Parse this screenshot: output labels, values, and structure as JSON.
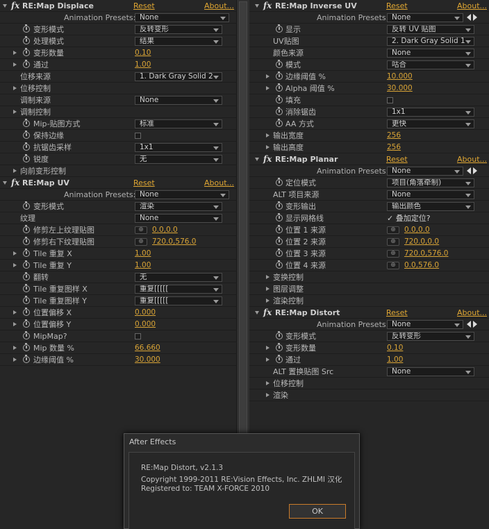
{
  "colors": {
    "accent": "#e0a733",
    "panel_bg": "#262626",
    "text": "#b9b9b9"
  },
  "left": {
    "sections": [
      {
        "name": "RE:Map Displace",
        "reset": "Reset",
        "about": "About...",
        "presets_label": "Animation Presets:",
        "presets_value": "None",
        "rows": [
          {
            "kind": "dd",
            "sw": true,
            "label": "变形模式",
            "value": "反转变形"
          },
          {
            "kind": "dd",
            "sw": true,
            "label": "处理模式",
            "value": "结果"
          },
          {
            "kind": "num",
            "tri": true,
            "sw": true,
            "label": "变形数量",
            "value": "0.10"
          },
          {
            "kind": "num",
            "tri": true,
            "sw": true,
            "label": "通过",
            "value": "1.00"
          },
          {
            "kind": "dd",
            "label": "位移来源",
            "value": "1. Dark Gray Solid 2",
            "indent": 1
          },
          {
            "kind": "group",
            "tri": true,
            "label": "位移控制"
          },
          {
            "kind": "dd",
            "label": "调制来源",
            "value": "None",
            "indent": 1
          },
          {
            "kind": "group",
            "tri": true,
            "label": "调制控制"
          },
          {
            "kind": "dd",
            "sw": true,
            "label": "Mip-贴图方式",
            "value": "标准"
          },
          {
            "kind": "cb",
            "sw": true,
            "label": "保持边缘",
            "value": ""
          },
          {
            "kind": "dd",
            "sw": true,
            "label": "抗锯齿采样",
            "value": "1x1"
          },
          {
            "kind": "dd",
            "sw": true,
            "label": "锐度",
            "value": "无"
          },
          {
            "kind": "group",
            "tri": true,
            "label": "向前变形控制"
          }
        ]
      },
      {
        "name": "RE:Map UV",
        "reset": "Reset",
        "about": "About...",
        "presets_label": "Animation Presets:",
        "presets_value": "None",
        "rows": [
          {
            "kind": "dd",
            "sw": true,
            "label": "变形模式",
            "value": "渲染"
          },
          {
            "kind": "dd",
            "label": "纹理",
            "value": "None",
            "indent": 1
          },
          {
            "kind": "pt",
            "sw": true,
            "label": "修剪左上纹理贴图",
            "value": "0.0,0.0"
          },
          {
            "kind": "pt",
            "sw": true,
            "label": "修剪右下纹理贴图",
            "value": "720.0,576.0"
          },
          {
            "kind": "num",
            "tri": true,
            "sw": true,
            "label": "Tile 重复 X",
            "value": "1.00"
          },
          {
            "kind": "num",
            "tri": true,
            "sw": true,
            "label": "Tile 重复 Y",
            "value": "1.00"
          },
          {
            "kind": "dd",
            "sw": true,
            "label": "翻转",
            "value": "无"
          },
          {
            "kind": "dd",
            "sw": true,
            "label": "Tile 重复图样 X",
            "value": "重复[[[[["
          },
          {
            "kind": "dd",
            "sw": true,
            "label": "Tile 重复图样 Y",
            "value": "重复[[[[["
          },
          {
            "kind": "num",
            "tri": true,
            "sw": true,
            "label": "位置偏移 X",
            "value": "0.000"
          },
          {
            "kind": "num",
            "tri": true,
            "sw": true,
            "label": "位置偏移 Y",
            "value": "0.000"
          },
          {
            "kind": "cb",
            "sw": true,
            "label": "MipMap?",
            "value": ""
          },
          {
            "kind": "num",
            "tri": true,
            "sw": true,
            "label": "Mip 数量 %",
            "value": "66.660"
          },
          {
            "kind": "num",
            "tri": true,
            "sw": true,
            "label": "边缘阈值 %",
            "value": "30.000"
          }
        ]
      }
    ]
  },
  "right": {
    "sections": [
      {
        "name": "RE:Map Inverse UV",
        "reset": "Reset",
        "about": "About...",
        "presets_label": "Animation Presets:",
        "presets_value": "None",
        "rows": [
          {
            "kind": "dd",
            "sw": true,
            "label": "显示",
            "value": "反转 UV 贴图"
          },
          {
            "kind": "dd",
            "label": "UV贴图",
            "value": "2. Dark Gray Solid 1",
            "indent": 1
          },
          {
            "kind": "dd",
            "label": "颜色来源",
            "value": "None",
            "indent": 1
          },
          {
            "kind": "dd",
            "sw": true,
            "label": "模式",
            "value": "咕合"
          },
          {
            "kind": "num",
            "tri": true,
            "sw": true,
            "label": "边缘阈值 %",
            "value": "10.000"
          },
          {
            "kind": "num",
            "tri": true,
            "sw": true,
            "label": "Alpha 阈值 %",
            "value": "30.000"
          },
          {
            "kind": "cb",
            "sw": true,
            "label": "填充",
            "value": ""
          },
          {
            "kind": "dd",
            "sw": true,
            "label": "消除锯齿",
            "value": "1x1"
          },
          {
            "kind": "dd",
            "sw": true,
            "label": "AA 方式",
            "value": "更快"
          },
          {
            "kind": "num",
            "tri": true,
            "label": "输出宽度",
            "value": "256"
          },
          {
            "kind": "num",
            "tri": true,
            "label": "输出高度",
            "value": "256"
          }
        ]
      },
      {
        "name": "RE:Map Planar",
        "reset": "Reset",
        "about": "About...",
        "presets_label": "Animation Presets:",
        "presets_value": "None",
        "rows": [
          {
            "kind": "dd",
            "sw": true,
            "label": "定位模式",
            "value": "项目(角落牵制)"
          },
          {
            "kind": "dd",
            "label": "ALT 项目来源",
            "value": "None",
            "indent": 1
          },
          {
            "kind": "dd",
            "sw": true,
            "label": "变形输出",
            "value": "输出颜色"
          },
          {
            "kind": "cbtxt",
            "sw": true,
            "label": "显示网格线",
            "value": "✓ 叠加定位?"
          },
          {
            "kind": "pt",
            "sw": true,
            "label": "位置 1 来源",
            "value": "0.0,0.0"
          },
          {
            "kind": "pt",
            "sw": true,
            "label": "位置 2 来源",
            "value": "720.0,0.0"
          },
          {
            "kind": "pt",
            "sw": true,
            "label": "位置 3 来源",
            "value": "720.0,576.0"
          },
          {
            "kind": "pt",
            "sw": true,
            "label": "位置 4 来源",
            "value": "0.0,576.0"
          },
          {
            "kind": "group",
            "tri": true,
            "label": "变换控制"
          },
          {
            "kind": "group",
            "tri": true,
            "label": "图层调整"
          },
          {
            "kind": "group",
            "tri": true,
            "label": "渲染控制"
          }
        ]
      },
      {
        "name": "RE:Map Distort",
        "reset": "Reset",
        "about": "About...",
        "presets_label": "Animation Presets:",
        "presets_value": "None",
        "rows": [
          {
            "kind": "dd",
            "sw": true,
            "label": "变形模式",
            "value": "反转变形"
          },
          {
            "kind": "num",
            "tri": true,
            "sw": true,
            "label": "变形数量",
            "value": "0.10"
          },
          {
            "kind": "num",
            "tri": true,
            "sw": true,
            "label": "通过",
            "value": "1.00"
          },
          {
            "kind": "dd",
            "label": "ALT 置换贴图 Src",
            "value": "None",
            "indent": 1
          },
          {
            "kind": "group",
            "tri": true,
            "label": "位移控制"
          },
          {
            "kind": "group",
            "tri": true,
            "label": "渲染"
          }
        ]
      }
    ]
  },
  "dialog": {
    "title": "After Effects",
    "lines": [
      "RE:Map Distort, v2.1.3",
      "Copyright 1999-2011 RE:Vision Effects, Inc. ZHLMI 汉化",
      "Registered to: TEAM X-FORCE 2010"
    ],
    "ok_label": "OK"
  }
}
